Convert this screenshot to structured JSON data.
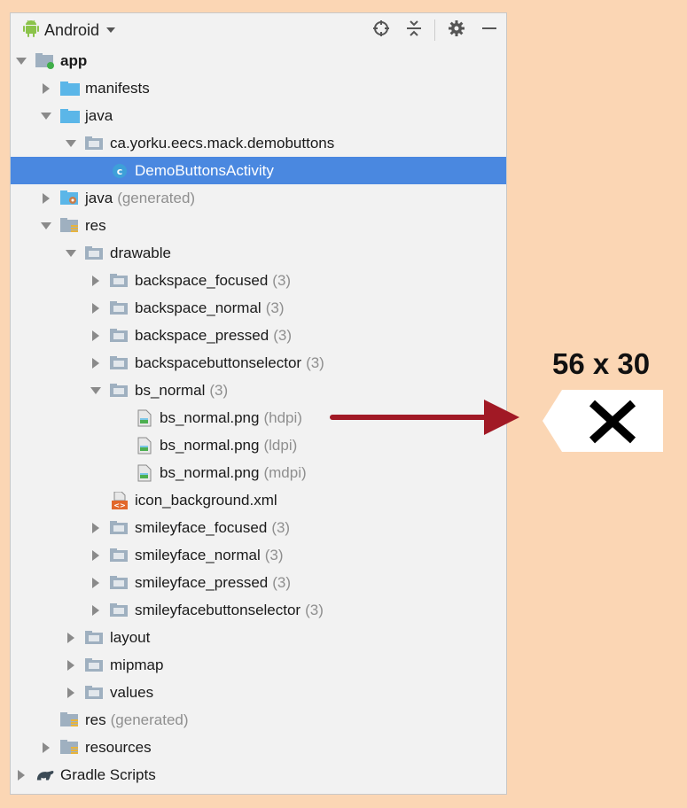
{
  "toolbar": {
    "project_view": "Android"
  },
  "tree": [
    {
      "label": "app",
      "suffix": "",
      "indent": 0,
      "arrow": "down",
      "icon": "module-folder-icon",
      "bold": true
    },
    {
      "label": "manifests",
      "suffix": "",
      "indent": 1,
      "arrow": "right",
      "icon": "folder-icon"
    },
    {
      "label": "java",
      "suffix": "",
      "indent": 1,
      "arrow": "down",
      "icon": "folder-icon"
    },
    {
      "label": "ca.yorku.eecs.mack.demobuttons",
      "suffix": "",
      "indent": 2,
      "arrow": "down",
      "icon": "package-icon"
    },
    {
      "label": "DemoButtonsActivity",
      "suffix": "",
      "indent": 3,
      "arrow": "none",
      "icon": "class-icon",
      "selected": true
    },
    {
      "label": "java",
      "suffix": "(generated)",
      "indent": 1,
      "arrow": "right",
      "icon": "generated-folder-icon"
    },
    {
      "label": "res",
      "suffix": "",
      "indent": 1,
      "arrow": "down",
      "icon": "resources-folder-icon"
    },
    {
      "label": "drawable",
      "suffix": "",
      "indent": 2,
      "arrow": "down",
      "icon": "package-icon"
    },
    {
      "label": "backspace_focused",
      "suffix": "(3)",
      "indent": 3,
      "arrow": "right",
      "icon": "package-icon"
    },
    {
      "label": "backspace_normal",
      "suffix": "(3)",
      "indent": 3,
      "arrow": "right",
      "icon": "package-icon"
    },
    {
      "label": "backspace_pressed",
      "suffix": "(3)",
      "indent": 3,
      "arrow": "right",
      "icon": "package-icon"
    },
    {
      "label": "backspacebuttonselector",
      "suffix": "(3)",
      "indent": 3,
      "arrow": "right",
      "icon": "package-icon"
    },
    {
      "label": "bs_normal",
      "suffix": "(3)",
      "indent": 3,
      "arrow": "down",
      "icon": "package-icon"
    },
    {
      "label": "bs_normal.png",
      "suffix": "(hdpi)",
      "indent": 4,
      "arrow": "none",
      "icon": "image-file-icon"
    },
    {
      "label": "bs_normal.png",
      "suffix": "(ldpi)",
      "indent": 4,
      "arrow": "none",
      "icon": "image-file-icon"
    },
    {
      "label": "bs_normal.png",
      "suffix": "(mdpi)",
      "indent": 4,
      "arrow": "none",
      "icon": "image-file-icon"
    },
    {
      "label": "icon_background.xml",
      "suffix": "",
      "indent": 3,
      "arrow": "none",
      "icon": "xml-file-icon"
    },
    {
      "label": "smileyface_focused",
      "suffix": "(3)",
      "indent": 3,
      "arrow": "right",
      "icon": "package-icon"
    },
    {
      "label": "smileyface_normal",
      "suffix": "(3)",
      "indent": 3,
      "arrow": "right",
      "icon": "package-icon"
    },
    {
      "label": "smileyface_pressed",
      "suffix": "(3)",
      "indent": 3,
      "arrow": "right",
      "icon": "package-icon"
    },
    {
      "label": "smileyfacebuttonselector",
      "suffix": "(3)",
      "indent": 3,
      "arrow": "right",
      "icon": "package-icon"
    },
    {
      "label": "layout",
      "suffix": "",
      "indent": 2,
      "arrow": "right",
      "icon": "package-icon"
    },
    {
      "label": "mipmap",
      "suffix": "",
      "indent": 2,
      "arrow": "right",
      "icon": "package-icon"
    },
    {
      "label": "values",
      "suffix": "",
      "indent": 2,
      "arrow": "right",
      "icon": "package-icon"
    },
    {
      "label": "res",
      "suffix": "(generated)",
      "indent": 1,
      "arrow": "none",
      "icon": "resources-folder-icon"
    },
    {
      "label": "resources",
      "suffix": "",
      "indent": 1,
      "arrow": "right",
      "icon": "resources-folder-icon"
    },
    {
      "label": "Gradle Scripts",
      "suffix": "",
      "indent": 0,
      "arrow": "right",
      "icon": "gradle-icon"
    }
  ],
  "annotation": {
    "size_label": "56 x 30"
  },
  "colors": {
    "background": "#fbd6b4",
    "selection": "#4a88e0",
    "arrow": "#a11925"
  }
}
